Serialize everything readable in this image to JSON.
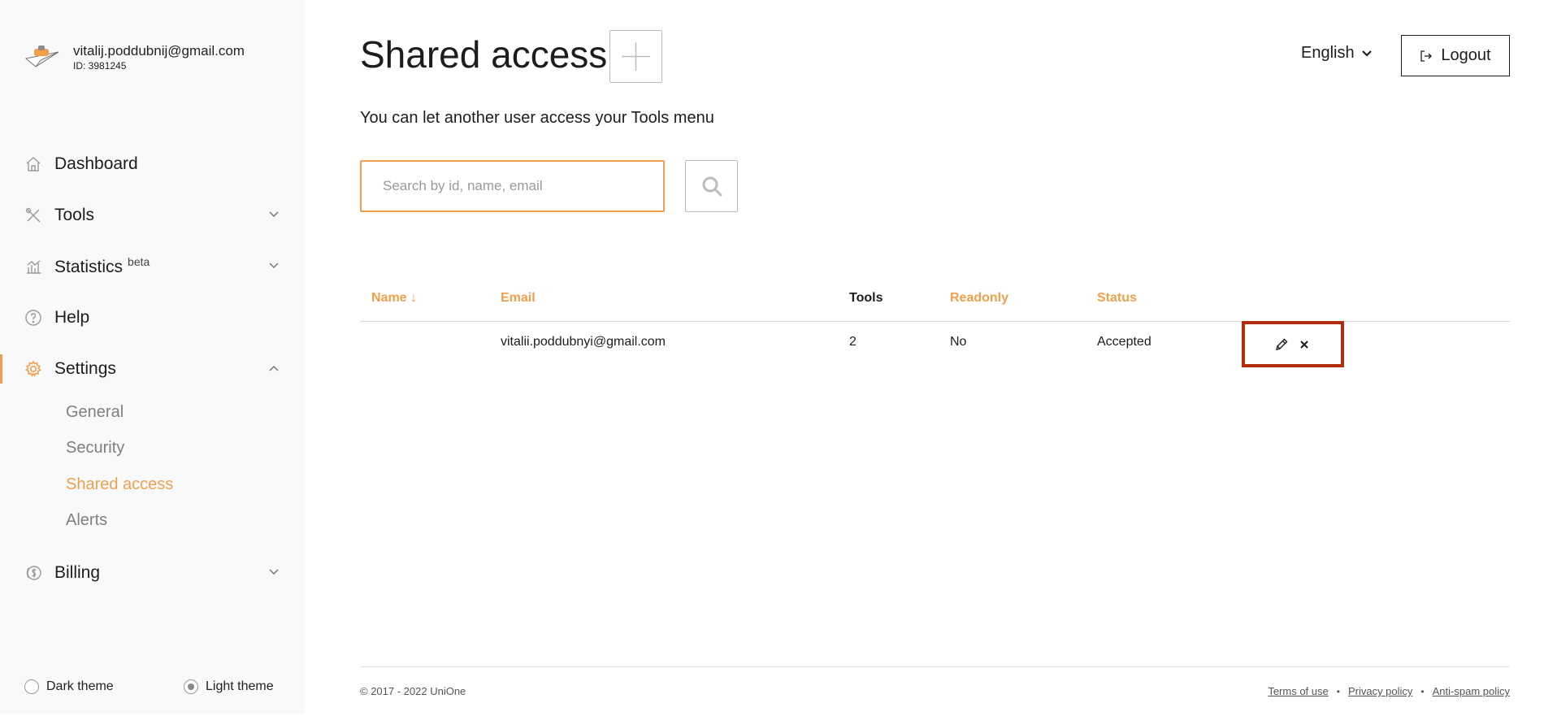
{
  "user": {
    "email": "vitalij.poddubnij@gmail.com",
    "id": "ID: 3981245"
  },
  "nav": {
    "dashboard": "Dashboard",
    "tools": "Tools",
    "statistics": "Statistics",
    "statistics_badge": "beta",
    "help": "Help",
    "settings": "Settings",
    "settings_sub": [
      "General",
      "Security",
      "Shared access",
      "Alerts"
    ],
    "billing": "Billing"
  },
  "theme": {
    "dark": "Dark theme",
    "light": "Light theme",
    "selected": "light"
  },
  "header": {
    "title": "Shared access",
    "language": "English",
    "logout": "Logout"
  },
  "subtitle": "You can let another user access your Tools menu",
  "search": {
    "placeholder": "Search by id, name, email",
    "value": ""
  },
  "table": {
    "headers": {
      "name": "Name ↓",
      "email": "Email",
      "tools": "Tools",
      "readonly": "Readonly",
      "status": "Status"
    },
    "rows": [
      {
        "name": "",
        "email": "vitalii.poddubnyi@gmail.com",
        "tools": "2",
        "readonly": "No",
        "status": "Accepted"
      }
    ]
  },
  "footer": {
    "copyright": "© 2017 - 2022 UniOne",
    "links": [
      "Terms of use",
      "Privacy policy",
      "Anti-spam policy"
    ]
  },
  "colors": {
    "accent": "#f0a04b",
    "highlight": "#b32d0d",
    "sidebar_bg": "#f8f9fb"
  },
  "icons": {
    "dashboard": "home-icon",
    "tools": "tools-icon",
    "statistics": "chart-icon",
    "help": "help-icon",
    "settings": "gear-icon",
    "billing": "billing-icon",
    "edit": "pencil-icon",
    "delete": "close-icon"
  }
}
